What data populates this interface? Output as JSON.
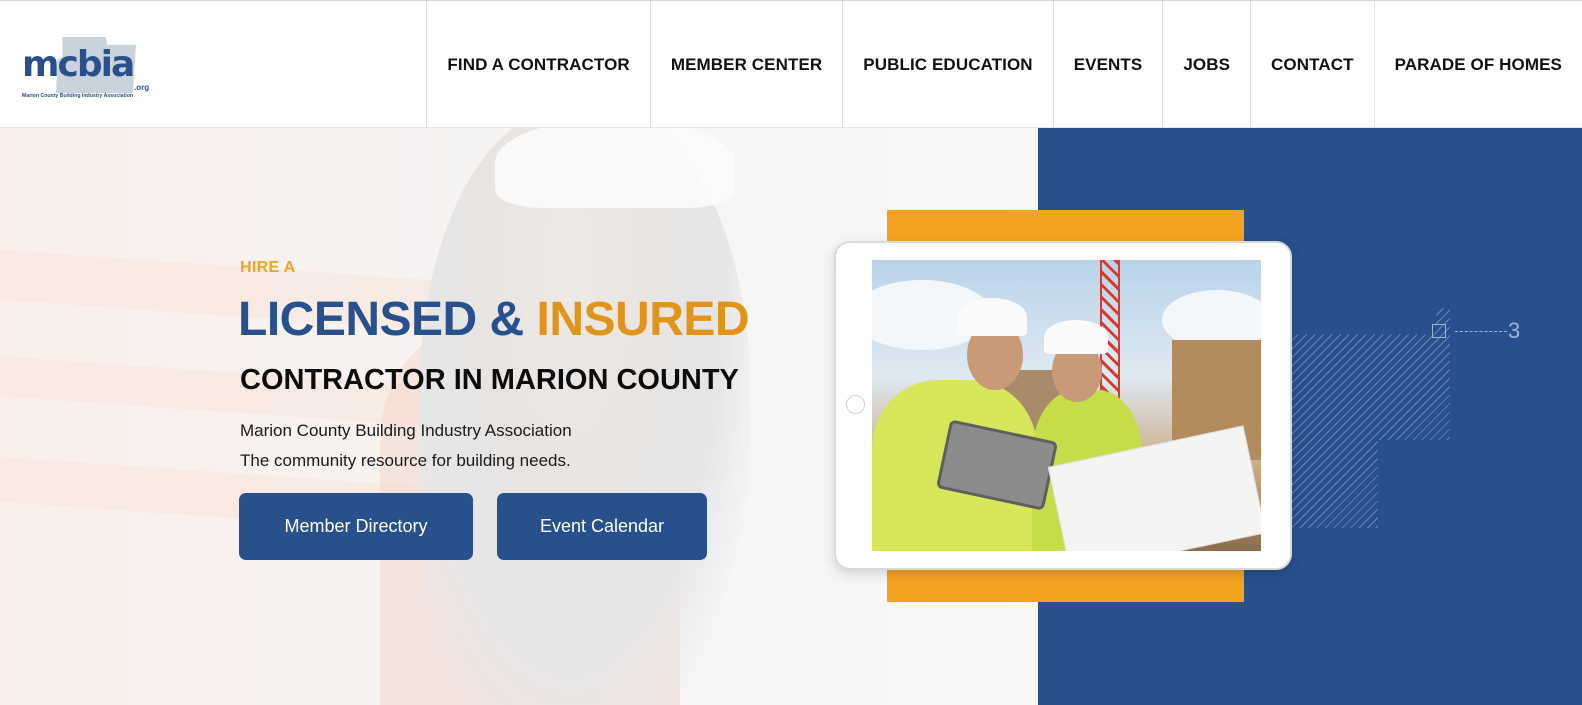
{
  "brand": {
    "logo_text": "mcbia",
    "logo_suffix": ".org",
    "logo_tagline": "Marion County Building Industry Association"
  },
  "nav": {
    "items": [
      {
        "label": "FIND A CONTRACTOR"
      },
      {
        "label": "MEMBER CENTER"
      },
      {
        "label": "PUBLIC EDUCATION"
      },
      {
        "label": "EVENTS"
      },
      {
        "label": "JOBS"
      },
      {
        "label": "CONTACT"
      },
      {
        "label": "PARADE OF HOMES"
      }
    ]
  },
  "hero": {
    "eyebrow": "HIRE A",
    "headline_part1": "LICENSED & ",
    "headline_part2": "INSURED",
    "subhead": "CONTRACTOR IN MARION COUNTY",
    "desc_line1": "Marion County Building Industry Association",
    "desc_line2": "The community resource for building needs.",
    "btn_primary": "Member Directory",
    "btn_secondary": "Event Calendar",
    "blueprint_number": "3"
  },
  "colors": {
    "brand_blue": "#27508c",
    "accent_orange": "#f0a323",
    "gold": "#f2a31f"
  }
}
